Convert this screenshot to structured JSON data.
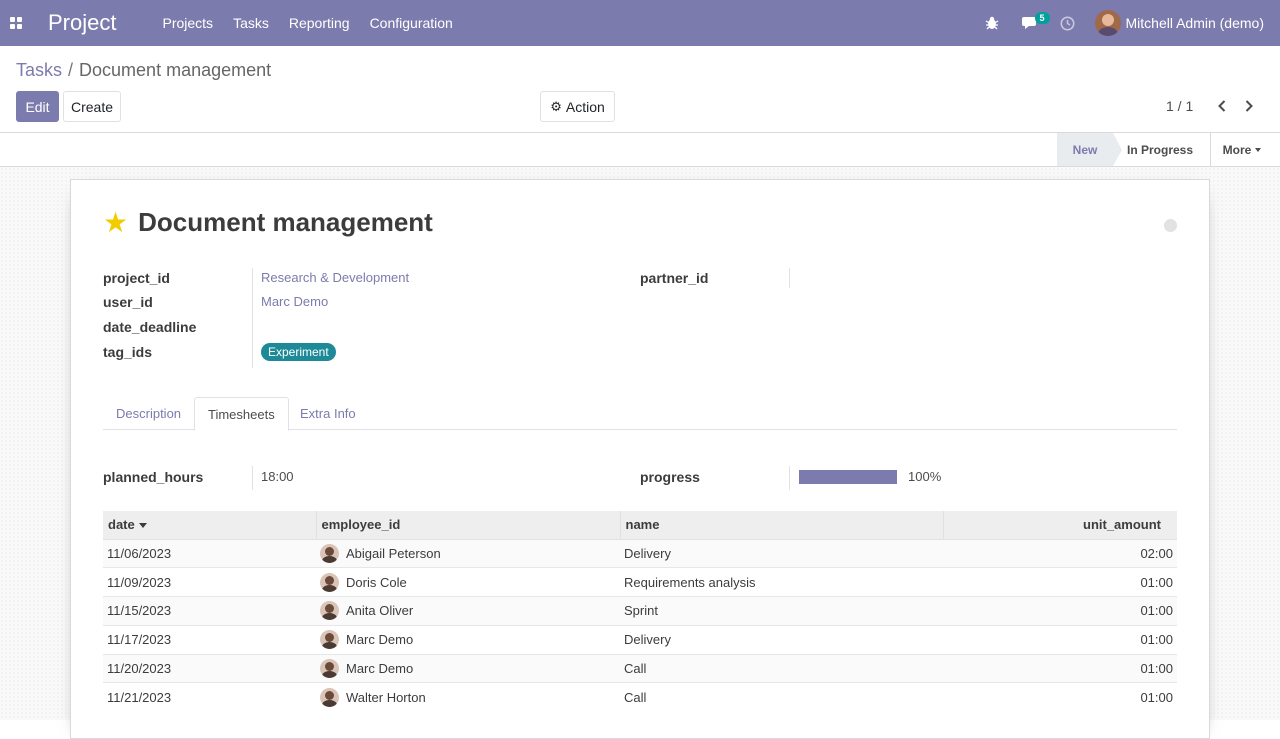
{
  "navbar": {
    "brand": "Project",
    "menu": [
      "Projects",
      "Tasks",
      "Reporting",
      "Configuration"
    ],
    "messages_count": "5",
    "user_name": "Mitchell Admin (demo)",
    "icons": [
      "apps-grid-icon",
      "bug-icon",
      "chat-icon",
      "clock-icon"
    ],
    "color": "#7c7bad"
  },
  "breadcrumb": {
    "parent": "Tasks",
    "separator": "/",
    "current": "Document management"
  },
  "buttons": {
    "edit": "Edit",
    "create": "Create",
    "action": "Action"
  },
  "pager": {
    "value": "1 / 1"
  },
  "statusbar": {
    "stages": [
      "New",
      "In Progress"
    ],
    "active_stage": "New",
    "more": "More"
  },
  "task": {
    "title": "Document management",
    "starred": true,
    "fields": {
      "project_id": {
        "label": "project_id",
        "value": "Research & Development"
      },
      "user_id": {
        "label": "user_id",
        "value": "Marc Demo"
      },
      "date_deadline": {
        "label": "date_deadline",
        "value": ""
      },
      "tag_ids": {
        "label": "tag_ids",
        "value": "Experiment"
      },
      "partner_id": {
        "label": "partner_id",
        "value": ""
      }
    }
  },
  "tabs": [
    "Description",
    "Timesheets",
    "Extra Info"
  ],
  "active_tab": "Timesheets",
  "timesheets": {
    "planned_hours": {
      "label": "planned_hours",
      "value": "18:00"
    },
    "progress": {
      "label": "progress",
      "value": "100%",
      "fraction": 1.0
    },
    "columns": [
      "date",
      "employee_id",
      "name",
      "unit_amount"
    ],
    "rows": [
      {
        "date": "11/06/2023",
        "employee": "Abigail Peterson",
        "name": "Delivery",
        "amount": "02:00"
      },
      {
        "date": "11/09/2023",
        "employee": "Doris Cole",
        "name": "Requirements analysis",
        "amount": "01:00"
      },
      {
        "date": "11/15/2023",
        "employee": "Anita Oliver",
        "name": "Sprint",
        "amount": "01:00"
      },
      {
        "date": "11/17/2023",
        "employee": "Marc Demo",
        "name": "Delivery",
        "amount": "01:00"
      },
      {
        "date": "11/20/2023",
        "employee": "Marc Demo",
        "name": "Call",
        "amount": "01:00"
      },
      {
        "date": "11/21/2023",
        "employee": "Walter Horton",
        "name": "Call",
        "amount": "01:00"
      }
    ]
  }
}
